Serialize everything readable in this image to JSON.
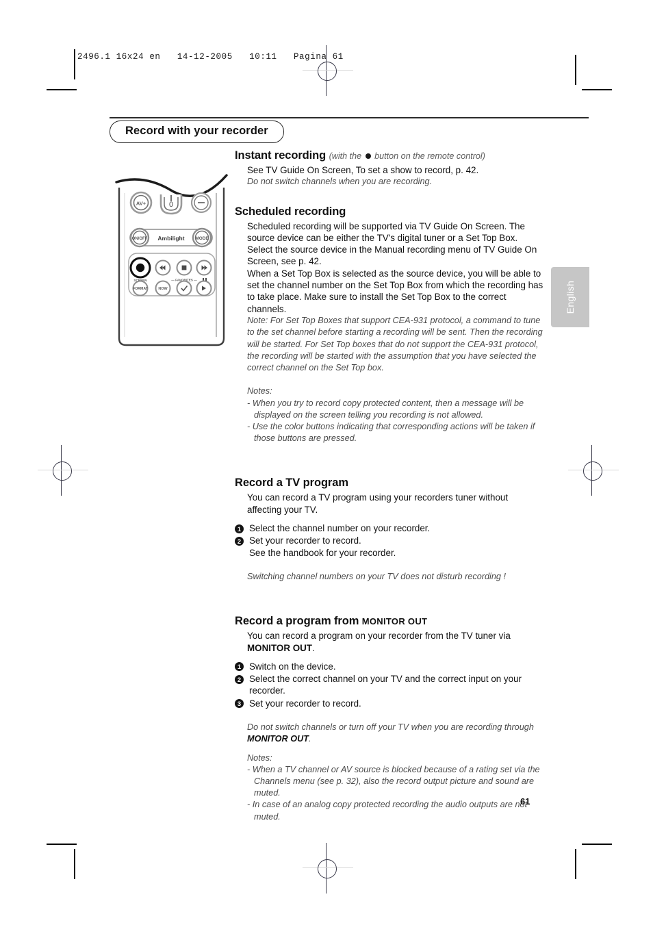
{
  "prepress": {
    "slug": "2496.1 16x24 en   14-12-2005   10:11   Pagina 61"
  },
  "chapter": {
    "title": "Record with your recorder"
  },
  "language_tab": {
    "label": "English"
  },
  "page": {
    "number": "61"
  },
  "sections": {
    "instant": {
      "heading": "Instant recording",
      "heading_paren_pre": "(with the",
      "heading_paren_post": "button on the remote control)",
      "body": "See TV Guide On Screen, To set a show to record, p. 42.",
      "italic": "Do not switch channels when you are recording."
    },
    "scheduled": {
      "heading": "Scheduled recording",
      "p1": "Scheduled recording will be supported via TV Guide On Screen. The source device can be either the TV's digital tuner or a Set Top Box. Select the source device in the Manual recording menu of TV Guide On Screen, see p. 42.",
      "p2": "When a Set Top Box is selected as the source device, you will be able to set the channel number on the Set Top Box from which the recording has to take place. Make sure to install the Set Top Box to the correct channels.",
      "note": "Note: For Set Top Boxes that support CEA-931 protocol, a command to tune to the set channel before starting a recording will be sent. Then the recording will be started. For Set Top boxes that do not support the CEA-931 protocol, the recording will be started with the assumption that you have selected the correct channel on the Set Top box.",
      "notes_label": "Notes:",
      "notes": [
        "- When you try to record copy protected content, then a message will be displayed on the screen telling you recording is not allowed.",
        "- Use the color buttons indicating that corresponding actions will be taken if those buttons are pressed."
      ]
    },
    "record_tv": {
      "heading": "Record a TV program",
      "body": "You can record a TV program using your recorders tuner without affecting your TV.",
      "steps": [
        {
          "num": "1",
          "text": "Select the channel number on your recorder."
        },
        {
          "num": "2",
          "text": "Set your recorder to record.\nSee the handbook for your recorder."
        }
      ],
      "italic": "Switching channel numbers on your TV does not disturb recording !"
    },
    "record_monitor": {
      "heading_main": "Record a program from",
      "heading_sc": "MONITOR OUT",
      "body_pre": "You can record a program on your recorder from the TV tuner via",
      "body_bold": "MONITOR OUT",
      "body_post": ".",
      "steps": [
        {
          "num": "1",
          "text": "Switch on the device."
        },
        {
          "num": "2",
          "text": "Select the correct channel on your TV and the correct input on your recorder."
        },
        {
          "num": "3",
          "text": "Set your recorder to record."
        }
      ],
      "warning_pre": "Do not switch channels or turn off your TV when you are recording through",
      "warning_bold": "MONITOR OUT",
      "warning_post": ".",
      "notes_label": "Notes:",
      "notes": [
        "- When a TV channel or AV source is blocked because of a rating set via the Channels menu (see p. 32), also the record output picture and sound are muted.",
        "- In case of an analog copy protected recording the audio outputs are not muted."
      ]
    }
  },
  "remote": {
    "buttons": {
      "av_plus": "AV+",
      "mute": "Ɉ",
      "minus": "-",
      "onoff": "ON/OFF",
      "ambilight": "Ambilight",
      "mode": "MODE",
      "screen_format_label": "SCREEN",
      "format": "FORMAT",
      "favorites_label": "— FAVORITES —",
      "now": "NOW"
    }
  },
  "colors": {
    "text": "#111111",
    "italic_text": "#4a4a4a",
    "tab_gray": "#c6c6c6",
    "remote_gray": "#8d8d8d"
  }
}
